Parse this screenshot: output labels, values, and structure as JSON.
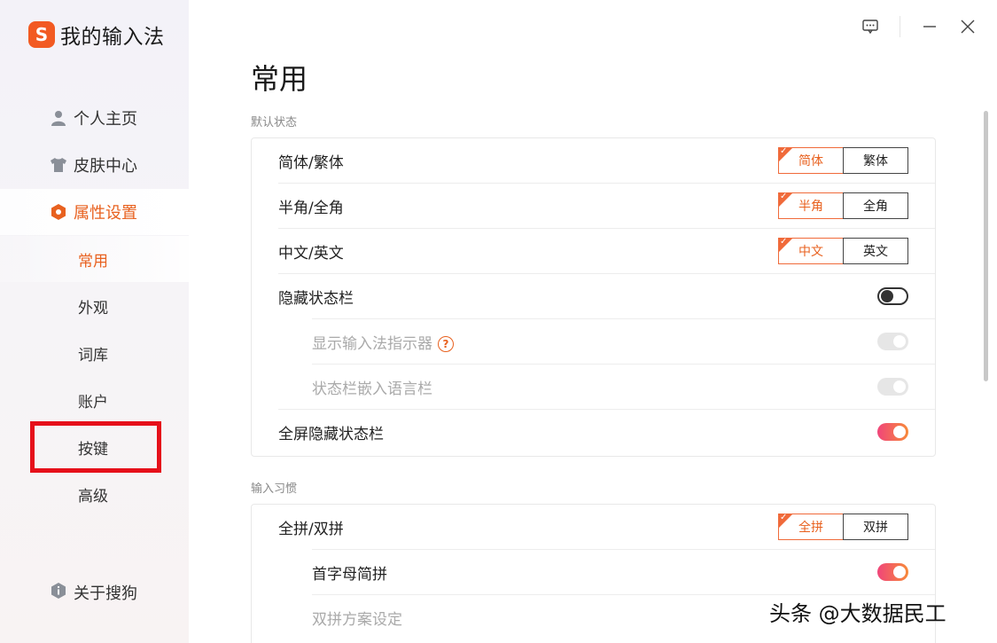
{
  "app": {
    "title": "我的输入法",
    "logo_letter": "S"
  },
  "sidebar": {
    "items": [
      {
        "label": "个人主页",
        "icon": "user-icon"
      },
      {
        "label": "皮肤中心",
        "icon": "shirt-icon"
      },
      {
        "label": "属性设置",
        "icon": "hexagon-settings-icon"
      }
    ],
    "sub_items": [
      {
        "label": "常用"
      },
      {
        "label": "外观"
      },
      {
        "label": "词库"
      },
      {
        "label": "账户"
      },
      {
        "label": "按键"
      },
      {
        "label": "高级"
      }
    ],
    "about": {
      "label": "关于搜狗",
      "icon": "info-hexagon-icon"
    }
  },
  "window": {
    "feedback_icon": "feedback-icon",
    "minimize_icon": "minimize-icon",
    "close_icon": "close-icon"
  },
  "page": {
    "title": "常用",
    "sections": [
      {
        "label": "默认状态",
        "rows": [
          {
            "label": "简体/繁体",
            "options": [
              "简体",
              "繁体"
            ],
            "selected": 0
          },
          {
            "label": "半角/全角",
            "options": [
              "半角",
              "全角"
            ],
            "selected": 0
          },
          {
            "label": "中文/英文",
            "options": [
              "中文",
              "英文"
            ],
            "selected": 0
          },
          {
            "label": "隐藏状态栏",
            "toggle": "off"
          },
          {
            "label": "显示输入法指示器",
            "toggle": "disabled",
            "help": "?"
          },
          {
            "label": "状态栏嵌入语言栏",
            "toggle": "disabled"
          },
          {
            "label": "全屏隐藏状态栏",
            "toggle": "on"
          }
        ]
      },
      {
        "label": "输入习惯",
        "rows": [
          {
            "label": "全拼/双拼",
            "options": [
              "全拼",
              "双拼"
            ],
            "selected": 0
          },
          {
            "label": "首字母简拼",
            "toggle": "on"
          },
          {
            "label": "双拼方案设定"
          }
        ]
      }
    ]
  },
  "watermark": "头条 @大数据民工",
  "colors": {
    "accent": "#e8611f",
    "highlight_box": "#e6101a",
    "toggle_on_start": "#f0457a",
    "toggle_on_end": "#f78a3a"
  }
}
